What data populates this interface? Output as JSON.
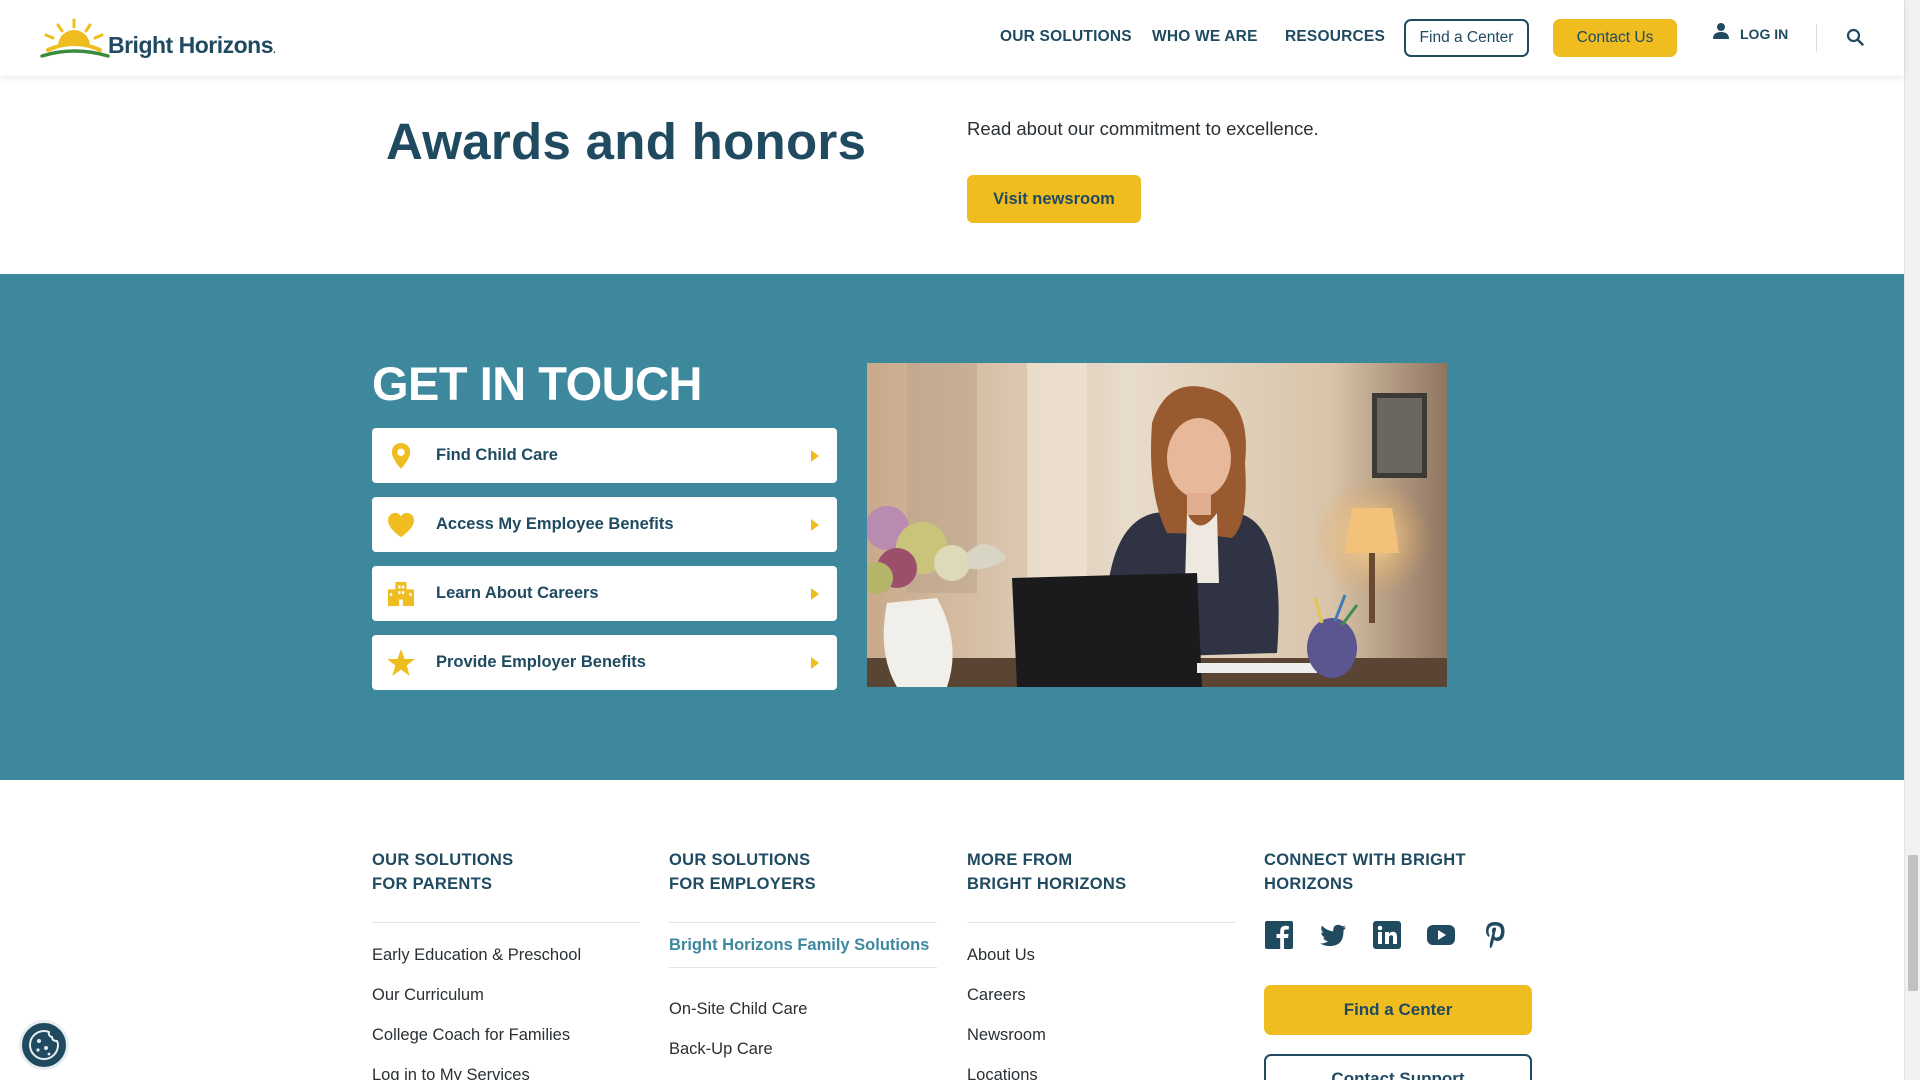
{
  "brand": {
    "name": "Bright Horizons",
    "tm": "."
  },
  "nav": {
    "links": [
      "OUR SOLUTIONS",
      "WHO WE ARE",
      "RESOURCES"
    ],
    "find_center": "Find a Center",
    "contact_us": "Contact Us",
    "login": "LOG IN"
  },
  "awards": {
    "title": "Awards and honors",
    "description": "Read about our commitment to excellence.",
    "button": "Visit newsroom"
  },
  "touch": {
    "title_light": "GET ",
    "title_bold": "IN TOUCH",
    "items": [
      {
        "label": "Find Child Care",
        "icon": "map-pin-icon"
      },
      {
        "label": "Access My Employee Benefits",
        "icon": "heart-icon"
      },
      {
        "label": "Learn About Careers",
        "icon": "building-icon"
      },
      {
        "label": "Provide Employer Benefits",
        "icon": "star-icon"
      }
    ],
    "photo_alt": "woman-at-laptop-photo"
  },
  "footer": {
    "parents": {
      "heading1": "OUR SOLUTIONS",
      "heading2": "FOR PARENTS",
      "links": [
        "Early Education & Preschool",
        "Our Curriculum",
        "College Coach for Families",
        "Log in to My Services"
      ]
    },
    "employers": {
      "heading1": "OUR SOLUTIONS",
      "heading2": "FOR EMPLOYERS",
      "highlight": "Bright Horizons Family Solutions",
      "links": [
        "On-Site Child Care",
        "Back-Up Care"
      ]
    },
    "more": {
      "heading1": "MORE FROM",
      "heading2": "BRIGHT HORIZONS",
      "links": [
        "About Us",
        "Careers",
        "Newsroom",
        "Locations"
      ]
    },
    "connect": {
      "heading1": "CONNECT WITH BRIGHT",
      "heading2": "HORIZONS",
      "social": [
        "facebook-icon",
        "twitter-icon",
        "linkedin-icon",
        "youtube-icon",
        "pinterest-icon"
      ],
      "find_center": "Find a Center",
      "contact_support": "Contact Support"
    }
  },
  "colors": {
    "navy": "#1f4a60",
    "teal": "#3e889e",
    "yellow": "#f0bd21",
    "green": "#3b8a3e"
  }
}
